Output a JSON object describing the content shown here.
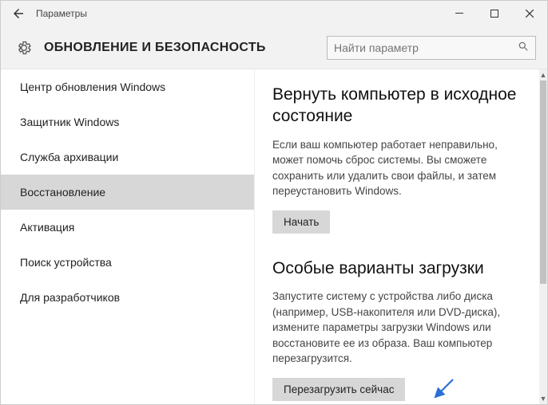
{
  "window": {
    "title": "Параметры"
  },
  "header": {
    "page_title": "ОБНОВЛЕНИЕ И БЕЗОПАСНОСТЬ",
    "search_placeholder": "Найти параметр"
  },
  "sidebar": {
    "items": [
      {
        "label": "Центр обновления Windows",
        "selected": false
      },
      {
        "label": "Защитник Windows",
        "selected": false
      },
      {
        "label": "Служба архивации",
        "selected": false
      },
      {
        "label": "Восстановление",
        "selected": true
      },
      {
        "label": "Активация",
        "selected": false
      },
      {
        "label": "Поиск устройства",
        "selected": false
      },
      {
        "label": "Для разработчиков",
        "selected": false
      }
    ]
  },
  "content": {
    "sec1": {
      "heading": "Вернуть компьютер в исходное состояние",
      "body": "Если ваш компьютер работает неправильно, может помочь сброс системы. Вы сможете сохранить или удалить свои файлы, и затем переустановить Windows.",
      "button": "Начать"
    },
    "sec2": {
      "heading": "Особые варианты загрузки",
      "body": "Запустите систему с устройства либо диска (например, USB-накопителя или DVD-диска), измените параметры загрузки Windows или восстановите ее из образа. Ваш компьютер перезагрузится.",
      "button": "Перезагрузить сейчас"
    }
  }
}
